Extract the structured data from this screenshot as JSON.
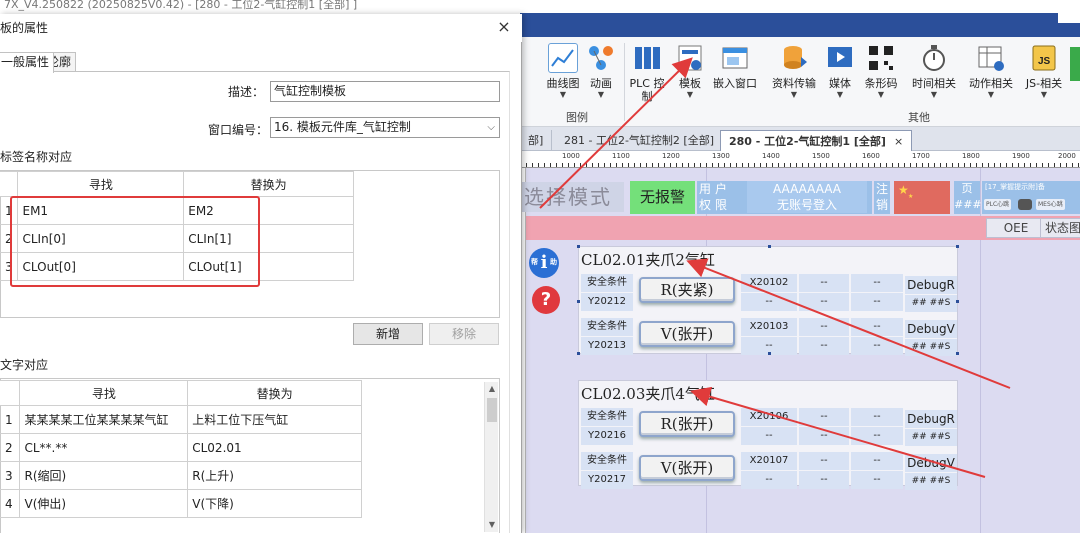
{
  "app": {
    "title": "7X_V4.250822 (20250825V0.42) - [280 - 工位2-气缸控制1 [全部] ]"
  },
  "ribbon": {
    "buttons": [
      {
        "label": "曲线图",
        "icon": "line-chart-icon"
      },
      {
        "label": "动画",
        "icon": "animation-icon"
      },
      {
        "label": "PLC 控",
        "icon": "plc-control-icon"
      },
      {
        "label": "模板",
        "icon": "template-icon"
      },
      {
        "label": "嵌入窗口",
        "icon": "embed-window-icon"
      },
      {
        "label": "资料传输",
        "icon": "data-transfer-icon"
      },
      {
        "label": "媒体",
        "icon": "media-icon"
      },
      {
        "label": "条形码",
        "icon": "barcode-icon"
      },
      {
        "label": "时间相关",
        "icon": "timer-icon"
      },
      {
        "label": "动作相关",
        "icon": "action-icon"
      },
      {
        "label": "JS-相关",
        "icon": "js-icon"
      }
    ],
    "plc_second_line": "制",
    "groups": {
      "chart": "图例",
      "other": "其他"
    }
  },
  "doc_tabs": [
    {
      "label": "部]"
    },
    {
      "label": "281 - 工位2-气缸控制2 [全部]"
    },
    {
      "label": "280 - 工位2-气缸控制1 [全部]",
      "close": "×"
    }
  ],
  "ruler": [
    "1000",
    "1100",
    "1200",
    "1300",
    "1400",
    "1500",
    "1600",
    "1700",
    "1800",
    "1900",
    "2000"
  ],
  "hmi": {
    "mode": "选择模式",
    "alarm": "无报警",
    "user_label": "用户",
    "user_value": "AAAAAAAA",
    "perm_label": "权限",
    "perm_value": "无账号登入",
    "cancel": "注销",
    "page_label": "页",
    "page_value": "####",
    "info_text": "[17_掌握提示附]备",
    "mini1": "PLC心跳",
    "mini2": "MES心跳",
    "tab1": "OEE",
    "tab2": "状态图",
    "help_side_left": "帮",
    "help_side_right": "助",
    "cylinders": [
      {
        "title": "CL02.01夹爪2气缸",
        "rows": [
          {
            "cond": "安全条件",
            "addr": "Y20212",
            "btn": "R(夹紧)",
            "x": "X20102",
            "d1": "--",
            "d2": "--",
            "d3": "--",
            "d4": "--",
            "d5": "--",
            "d6": "--",
            "dbg": "DebugR",
            "dbg2": "## ##S"
          },
          {
            "cond": "安全条件",
            "addr": "Y20213",
            "btn": "V(张开)",
            "x": "X20103",
            "d1": "--",
            "d2": "--",
            "d3": "--",
            "d4": "--",
            "d5": "--",
            "d6": "--",
            "dbg": "DebugV",
            "dbg2": "## ##S"
          }
        ]
      },
      {
        "title": "CL02.03夹爪4气缸",
        "rows": [
          {
            "cond": "安全条件",
            "addr": "Y20216",
            "btn": "R(张开)",
            "x": "X20106",
            "d1": "--",
            "d2": "--",
            "d3": "--",
            "d4": "--",
            "d5": "--",
            "d6": "--",
            "dbg": "DebugR",
            "dbg2": "## ##S"
          },
          {
            "cond": "安全条件",
            "addr": "Y20217",
            "btn": "V(张开)",
            "x": "X20107",
            "d1": "--",
            "d2": "--",
            "d3": "--",
            "d4": "--",
            "d5": "--",
            "d6": "--",
            "dbg": "DebugV",
            "dbg2": "## ##S"
          }
        ]
      }
    ]
  },
  "dialog": {
    "title": "板的属性",
    "close": "×",
    "tabs": [
      "一般属性",
      "轮廓"
    ],
    "desc_label": "描述：",
    "desc_value": "气缸控制模板",
    "window_label": "窗口编号：",
    "window_value": "16. 模板元件库_气缸控制",
    "tag_section": "标签名称对应",
    "tag_headers": {
      "find": "寻找",
      "replace": "替换为"
    },
    "tag_rows": [
      {
        "num": "1",
        "find": "EM1",
        "replace": "EM2"
      },
      {
        "num": "2",
        "find": "CLIn[0]",
        "replace": "CLIn[1]"
      },
      {
        "num": "3",
        "find": "CLOut[0]",
        "replace": "CLOut[1]"
      }
    ],
    "add_button": "新增",
    "remove_button": "移除",
    "text_section": "文字对应",
    "text_headers": {
      "find": "寻找",
      "replace": "替换为"
    },
    "text_rows": [
      {
        "num": "1",
        "find": "某某某某工位某某某某气缸",
        "replace": "上料工位下压气缸"
      },
      {
        "num": "2",
        "find": "CL**.**",
        "replace": "CL02.01"
      },
      {
        "num": "3",
        "find": "R(缩回)",
        "replace": "R(上升)"
      },
      {
        "num": "4",
        "find": "V(伸出)",
        "replace": "V(下降)"
      }
    ]
  },
  "colors": {
    "accent_red": "#e03b3b",
    "titlebar_blue": "#2b4f9a",
    "alarm_green": "#74e07a",
    "hmi_blue": "#9bc0e8"
  }
}
